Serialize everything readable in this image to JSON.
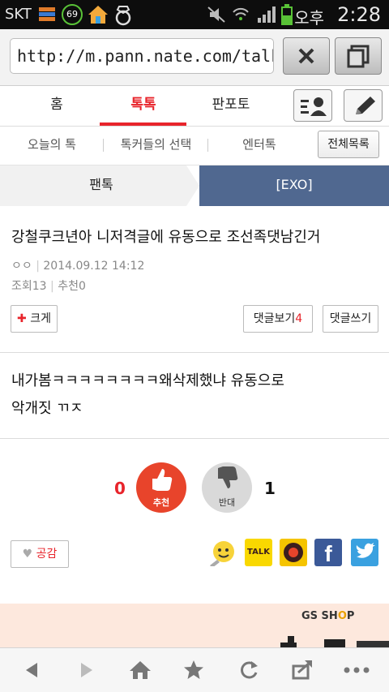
{
  "status_bar": {
    "carrier": "SKT",
    "badge_count": "69",
    "ampm": "오후",
    "time": "2:28"
  },
  "browser": {
    "url": "http://m.pann.nate.com/talk",
    "close_icon": "close-icon",
    "tabs_icon": "tabs-icon"
  },
  "nav": {
    "tabs": [
      {
        "label": "홈"
      },
      {
        "label": "톡톡"
      },
      {
        "label": "판포토"
      }
    ],
    "active_index": 1
  },
  "subnav": {
    "items": [
      {
        "label": "오늘의 톡"
      },
      {
        "label": "톡커들의 선택"
      },
      {
        "label": "엔터톡"
      }
    ],
    "all_label": "전체목록"
  },
  "breadcrumb": {
    "left": "팬톡",
    "right": "[EXO]"
  },
  "article": {
    "title": "강철쿠크년아 니저격글에 유동으로 조선족댓남긴거",
    "author": "ㅇㅇ",
    "date": "2014.09.12 14:12",
    "views_label": "조회",
    "views": "13",
    "recommend_label": "추천",
    "recommend": "0",
    "bigger_label": "크게",
    "comments_view_label": "댓글보기",
    "comments_count": "4",
    "comment_write_label": "댓글쓰기",
    "body_line1": "내가봄ㅋㅋㅋㅋㅋㅋㅋㅋ왜삭제했냐 유동으로",
    "body_line2": "악개짓 ㄲㅈ"
  },
  "vote": {
    "up_count": "0",
    "up_label": "추천",
    "down_count": "1",
    "down_label": "반대"
  },
  "like": {
    "label": "공감"
  },
  "share": {
    "kakaotalk_label": "TALK",
    "facebook_label": "f"
  },
  "banner": {
    "brand_main": "GS SH",
    "brand_o": "O",
    "brand_tail": "P"
  },
  "colors": {
    "accent": "#e8242b",
    "nav_blue": "#506890",
    "facebook": "#3b5998",
    "twitter": "#3aa1e0",
    "kakao": "#f9d800"
  }
}
